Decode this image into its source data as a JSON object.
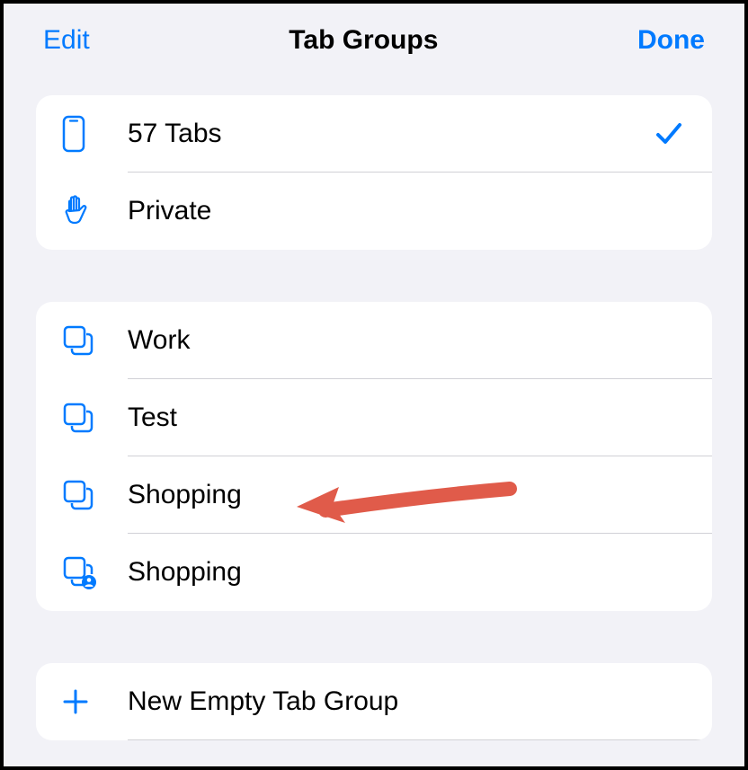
{
  "header": {
    "edit_label": "Edit",
    "title": "Tab Groups",
    "done_label": "Done"
  },
  "section1": {
    "items": [
      {
        "icon": "phone",
        "label": "57 Tabs",
        "checked": true
      },
      {
        "icon": "hand",
        "label": "Private",
        "checked": false
      }
    ]
  },
  "section2": {
    "items": [
      {
        "icon": "squares",
        "label": "Work"
      },
      {
        "icon": "squares",
        "label": "Test"
      },
      {
        "icon": "squares",
        "label": "Shopping"
      },
      {
        "icon": "squares-person",
        "label": "Shopping"
      }
    ]
  },
  "section3": {
    "items": [
      {
        "icon": "plus",
        "label": "New Empty Tab Group"
      }
    ]
  },
  "colors": {
    "accent": "#007aff",
    "arrow": "#e05b4a"
  }
}
